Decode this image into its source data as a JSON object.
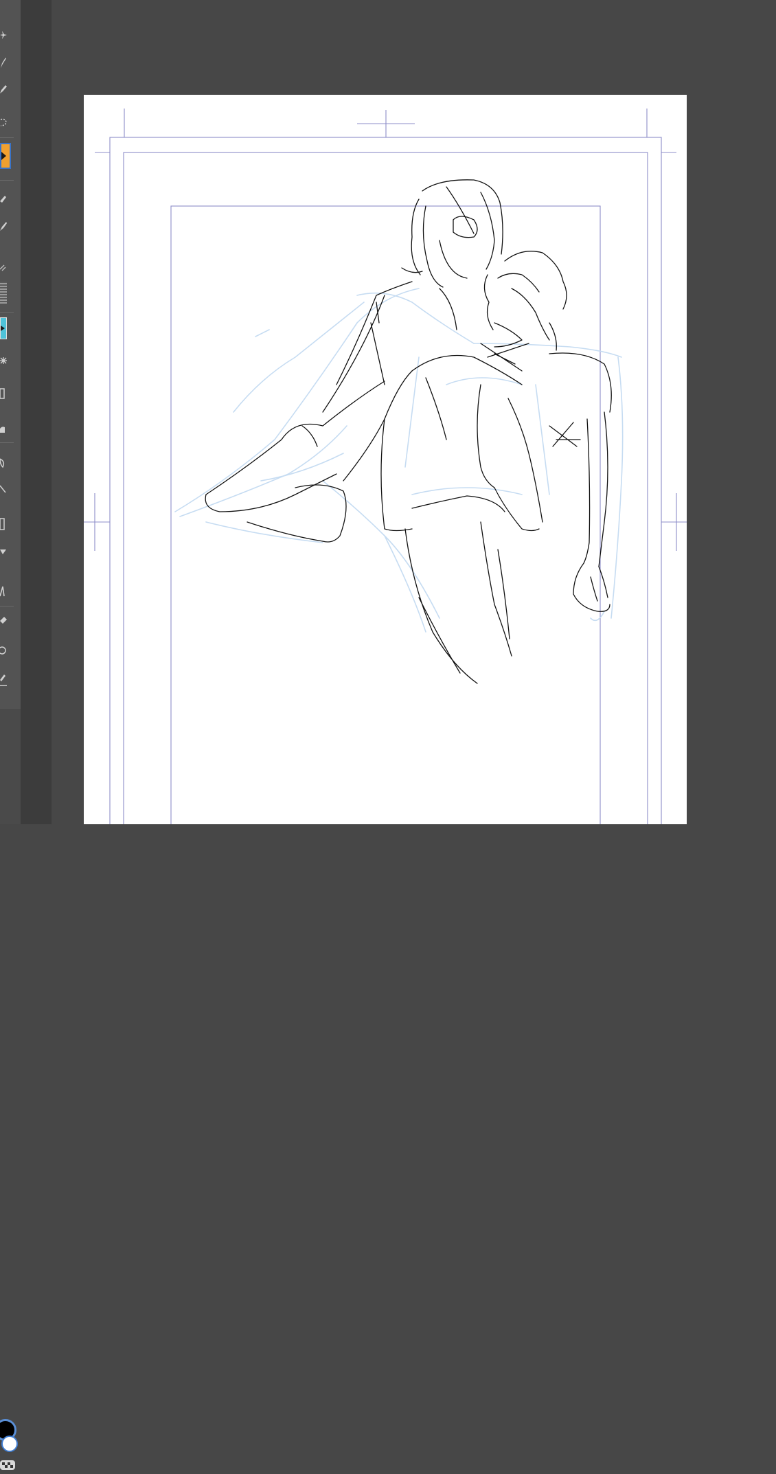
{
  "app": {
    "accent_color": "#f0a030",
    "secondary_accent": "#4fc3d9",
    "guide_color": "#8c8cc8",
    "sketch_color": "#111111",
    "rough_color": "#c6dcf2"
  },
  "toolbar": {
    "tools": [
      {
        "icon": "sparkle-icon",
        "active": false
      },
      {
        "icon": "pen-icon",
        "active": false
      },
      {
        "icon": "pencil-icon",
        "active": false
      },
      {
        "icon": "lasso-icon",
        "active": false
      },
      {
        "icon": "fill-bucket-icon",
        "active": true
      },
      {
        "icon": "eraser-icon",
        "active": false
      },
      {
        "icon": "brush-icon",
        "active": false
      },
      {
        "icon": "airbrush-icon",
        "active": false
      },
      {
        "icon": "texture-icon",
        "active": false
      },
      {
        "icon": "gradient-icon",
        "active": false
      },
      {
        "icon": "blend-icon",
        "active": false
      },
      {
        "icon": "frame-icon",
        "active": false
      },
      {
        "icon": "ruler-icon",
        "active": false
      },
      {
        "icon": "liquify-icon",
        "active": false
      },
      {
        "icon": "line-icon",
        "active": false
      },
      {
        "icon": "figure-icon",
        "active": false
      },
      {
        "icon": "shape-icon",
        "active": false
      },
      {
        "icon": "text-icon",
        "active": false
      },
      {
        "icon": "correction-icon",
        "active": false
      },
      {
        "icon": "balloon-icon",
        "active": false
      },
      {
        "icon": "eyedropper-icon",
        "active": false
      }
    ]
  },
  "colors": {
    "foreground": "#000000",
    "background": "#ffffff"
  }
}
